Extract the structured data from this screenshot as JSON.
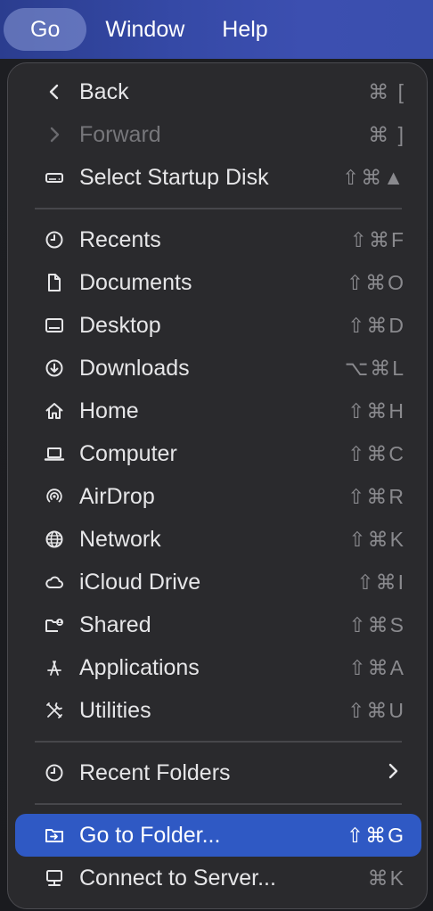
{
  "menubar": {
    "items": [
      {
        "label": "Go",
        "active": true
      },
      {
        "label": "Window",
        "active": false
      },
      {
        "label": "Help",
        "active": false
      }
    ]
  },
  "menu": {
    "items": [
      {
        "label": "Back",
        "shortcut": "⌘ [",
        "icon": "chevron-left-icon",
        "disabled": false
      },
      {
        "label": "Forward",
        "shortcut": "⌘ ]",
        "icon": "chevron-right-icon",
        "disabled": true
      },
      {
        "label": "Select Startup Disk",
        "shortcut": "⇧⌘▲",
        "icon": "disk-icon",
        "disabled": false
      },
      {
        "label": "Recents",
        "shortcut": "⇧⌘F",
        "icon": "clock-icon"
      },
      {
        "label": "Documents",
        "shortcut": "⇧⌘O",
        "icon": "document-icon"
      },
      {
        "label": "Desktop",
        "shortcut": "⇧⌘D",
        "icon": "desktop-icon"
      },
      {
        "label": "Downloads",
        "shortcut": "⌥⌘L",
        "icon": "download-icon"
      },
      {
        "label": "Home",
        "shortcut": "⇧⌘H",
        "icon": "home-icon"
      },
      {
        "label": "Computer",
        "shortcut": "⇧⌘C",
        "icon": "laptop-icon"
      },
      {
        "label": "AirDrop",
        "shortcut": "⇧⌘R",
        "icon": "airdrop-icon"
      },
      {
        "label": "Network",
        "shortcut": "⇧⌘K",
        "icon": "globe-icon"
      },
      {
        "label": "iCloud Drive",
        "shortcut": "⇧⌘I",
        "icon": "cloud-icon"
      },
      {
        "label": "Shared",
        "shortcut": "⇧⌘S",
        "icon": "shared-folder-icon"
      },
      {
        "label": "Applications",
        "shortcut": "⇧⌘A",
        "icon": "applications-icon"
      },
      {
        "label": "Utilities",
        "shortcut": "⇧⌘U",
        "icon": "tools-icon"
      },
      {
        "label": "Recent Folders",
        "shortcut": "",
        "icon": "clock-icon",
        "submenu": true
      },
      {
        "label": "Go to Folder...",
        "shortcut": "⇧⌘G",
        "icon": "folder-arrow-icon",
        "highlighted": true
      },
      {
        "label": "Connect to Server...",
        "shortcut": "⌘K",
        "icon": "server-icon"
      }
    ]
  },
  "colors": {
    "highlight": "#2f59c4",
    "menu_bg": "#2a2a2d",
    "menubar_blue": "#3549a6"
  }
}
